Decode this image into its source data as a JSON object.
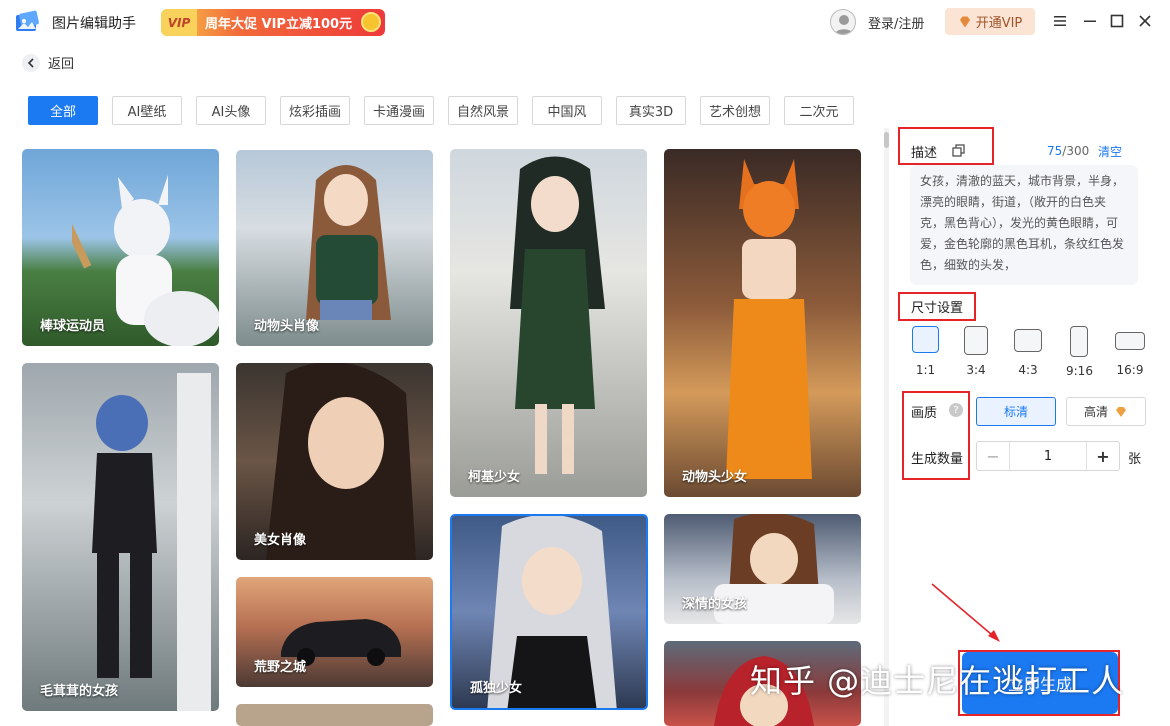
{
  "app": {
    "title": "图片编辑助手"
  },
  "promo": {
    "tag": "VIP",
    "text": "周年大促 VIP立减100元"
  },
  "header": {
    "login": "登录/注册",
    "vip_button": "开通VIP"
  },
  "nav": {
    "back": "返回"
  },
  "categories": [
    "全部",
    "AI壁纸",
    "AI头像",
    "炫彩插画",
    "卡通漫画",
    "自然风景",
    "中国风",
    "真实3D",
    "艺术创想",
    "二次元"
  ],
  "cards": [
    "棒球运动员",
    "动物头肖像",
    "柯基少女",
    "动物头少女",
    "毛茸茸的女孩",
    "美女肖像",
    "荒野之城",
    "孤独少女",
    "深情的女孩"
  ],
  "panel": {
    "desc_label": "描述",
    "desc_count": "75",
    "desc_max": "/300",
    "clear": "清空",
    "desc_text": "女孩，清澈的蓝天，城市背景，半身，漂亮的眼睛，街道，（敞开的白色夹克，黑色背心），发光的黄色眼睛，可爱，金色轮廓的黑色耳机，条纹红色发色，细致的头发，",
    "size_label": "尺寸设置",
    "ratios": [
      "1:1",
      "3:4",
      "4:3",
      "9:16",
      "16:9"
    ],
    "quality_label": "画质",
    "quality_standard": "标清",
    "quality_hd": "高清",
    "count_label": "生成数量",
    "count_value": "1",
    "count_unit": "张",
    "generate": "立即生成"
  },
  "watermark": "知乎 @迪士尼在逃打工人",
  "colors": {
    "accent": "#1b79f2",
    "annotation": "#e5242a"
  }
}
